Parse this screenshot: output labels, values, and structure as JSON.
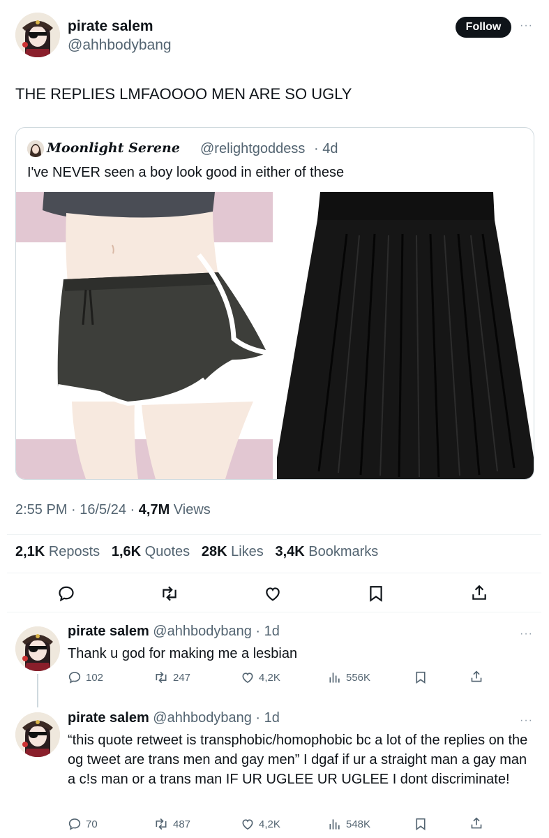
{
  "main_tweet": {
    "author_name": "pirate salem",
    "author_handle": "@ahhbodybang",
    "follow_label": "Follow",
    "more_label": "···",
    "text": "THE REPLIES LMFAOOOO MEN ARE SO UGLY",
    "quote": {
      "author_name": "Moonlight Serene",
      "author_handle": "@relightgoddess",
      "time": "· 4d",
      "text": "I've NEVER seen a boy look good in either of these"
    },
    "time": "2:55 PM · 16/5/24 · ",
    "views_count": "4,7M",
    "views_label": "Views",
    "stats": {
      "reposts_count": "2,1K",
      "reposts_label": "Reposts",
      "quotes_count": "1,6K",
      "quotes_label": "Quotes",
      "likes_count": "28K",
      "likes_label": "Likes",
      "bookmarks_count": "3,4K",
      "bookmarks_label": "Bookmarks"
    }
  },
  "replies": [
    {
      "author_name": "pirate salem",
      "author_handle": "@ahhbodybang",
      "time": "· 1d",
      "text": "Thank u god for making me a lesbian",
      "replies": "102",
      "reposts": "247",
      "likes": "4,2K",
      "views": "556K"
    },
    {
      "author_name": "pirate salem",
      "author_handle": "@ahhbodybang",
      "time": "· 1d",
      "text": "“this quote retweet is transphobic/homophobic bc a lot of the replies on the og tweet are trans men and gay men” I dgaf if ur a straight man a gay man a c!s man or a trans man IF UR UGLEE UR UGLEE I dont discriminate!",
      "replies": "70",
      "reposts": "487",
      "likes": "4,2K",
      "views": "548K"
    }
  ],
  "colors": {
    "text": "#0f1419",
    "muted": "#536471",
    "border": "#cfd9de",
    "pink_bg": "#e2c7d2"
  }
}
